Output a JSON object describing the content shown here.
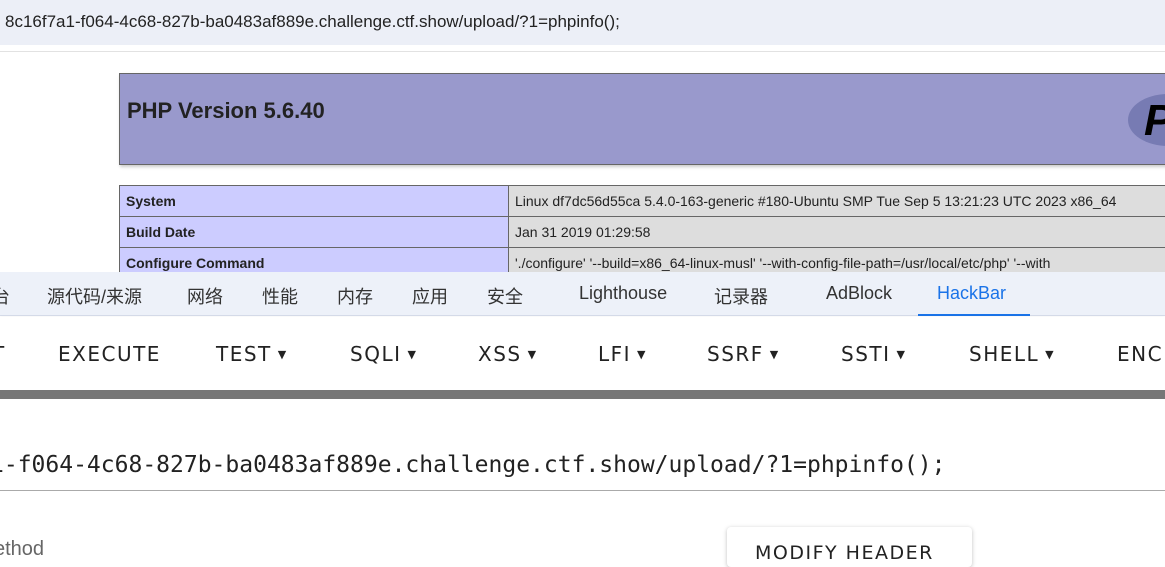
{
  "address_bar": {
    "url": "8c16f7a1-f064-4c68-827b-ba0483af889e.challenge.ctf.show/upload/?1=phpinfo();"
  },
  "phpinfo": {
    "title": "PHP Version 5.6.40",
    "logo_text": "php",
    "rows": [
      {
        "key": "System",
        "value": "Linux df7dc56d55ca 5.4.0-163-generic #180-Ubuntu SMP Tue Sep 5 13:21:23 UTC 2023 x86_64"
      },
      {
        "key": "Build Date",
        "value": "Jan 31 2019 01:29:58"
      },
      {
        "key": "Configure Command",
        "value": "'./configure' '--build=x86_64-linux-musl' '--with-config-file-path=/usr/local/etc/php' '--with"
      }
    ]
  },
  "devtools": {
    "tabs": [
      "台",
      "源代码/来源",
      "网络",
      "性能",
      "内存",
      "应用",
      "安全",
      "Lighthouse",
      "记录器",
      "AdBlock",
      "HackBar"
    ],
    "active_tab": "HackBar",
    "accent": "#1a73e8"
  },
  "hackbar": {
    "buttons": [
      {
        "label": "T",
        "dropdown": false
      },
      {
        "label": "EXECUTE",
        "dropdown": false
      },
      {
        "label": "TEST",
        "dropdown": true
      },
      {
        "label": "SQLI",
        "dropdown": true
      },
      {
        "label": "XSS",
        "dropdown": true
      },
      {
        "label": "LFI",
        "dropdown": true
      },
      {
        "label": "SSRF",
        "dropdown": true
      },
      {
        "label": "SSTI",
        "dropdown": true
      },
      {
        "label": "SHELL",
        "dropdown": true
      },
      {
        "label": "ENC",
        "dropdown": false
      }
    ],
    "url_value": "1-f064-4c68-827b-ba0483af889e.challenge.ctf.show/upload/?1=phpinfo();",
    "method_label": "ethod",
    "modify_header_label": "MODIFY HEADER"
  }
}
